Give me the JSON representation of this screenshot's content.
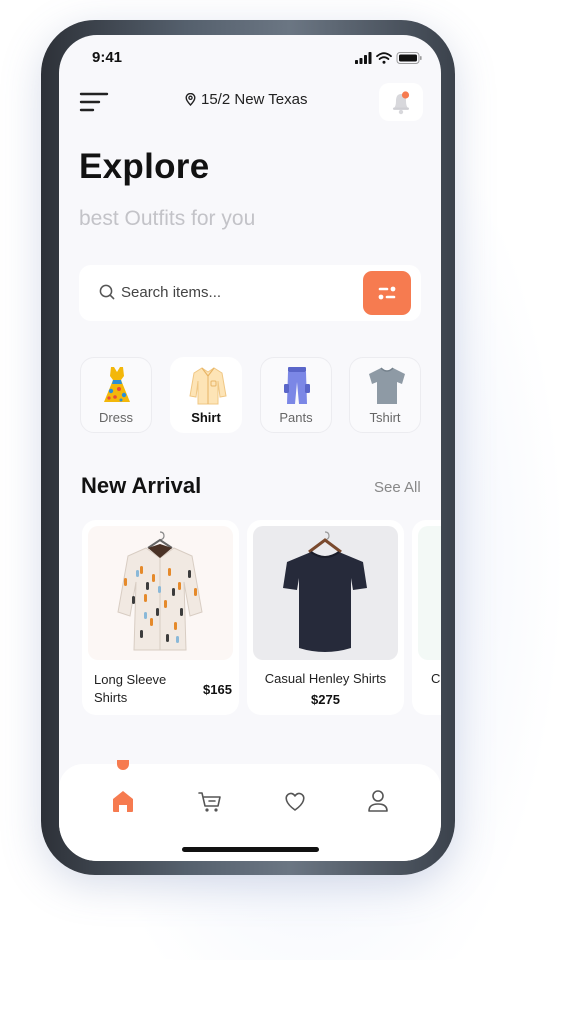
{
  "status": {
    "time": "9:41"
  },
  "header": {
    "location": "15/2 New Texas",
    "accent": "#f67b50"
  },
  "hero": {
    "title": "Explore",
    "subtitle": "best Outfits for you"
  },
  "search": {
    "placeholder": "Search items..."
  },
  "categories": [
    {
      "label": "Dress",
      "icon": "dress-icon",
      "active": false
    },
    {
      "label": "Shirt",
      "icon": "shirt-icon",
      "active": true
    },
    {
      "label": "Pants",
      "icon": "pants-icon",
      "active": false
    },
    {
      "label": "Tshirt",
      "icon": "tshirt-icon",
      "active": false
    }
  ],
  "new_arrival": {
    "title": "New Arrival",
    "see_all": "See All",
    "products": [
      {
        "name_line1": "Long Sleeve",
        "name_line2": "Shirts",
        "price": "$165"
      },
      {
        "name": "Casual Henley Shirts",
        "price": "$275"
      },
      {
        "name_partial": "C"
      }
    ]
  },
  "bottom_nav": [
    {
      "icon": "home-icon",
      "active": true
    },
    {
      "icon": "cart-icon",
      "active": false
    },
    {
      "icon": "heart-icon",
      "active": false
    },
    {
      "icon": "profile-icon",
      "active": false
    }
  ]
}
